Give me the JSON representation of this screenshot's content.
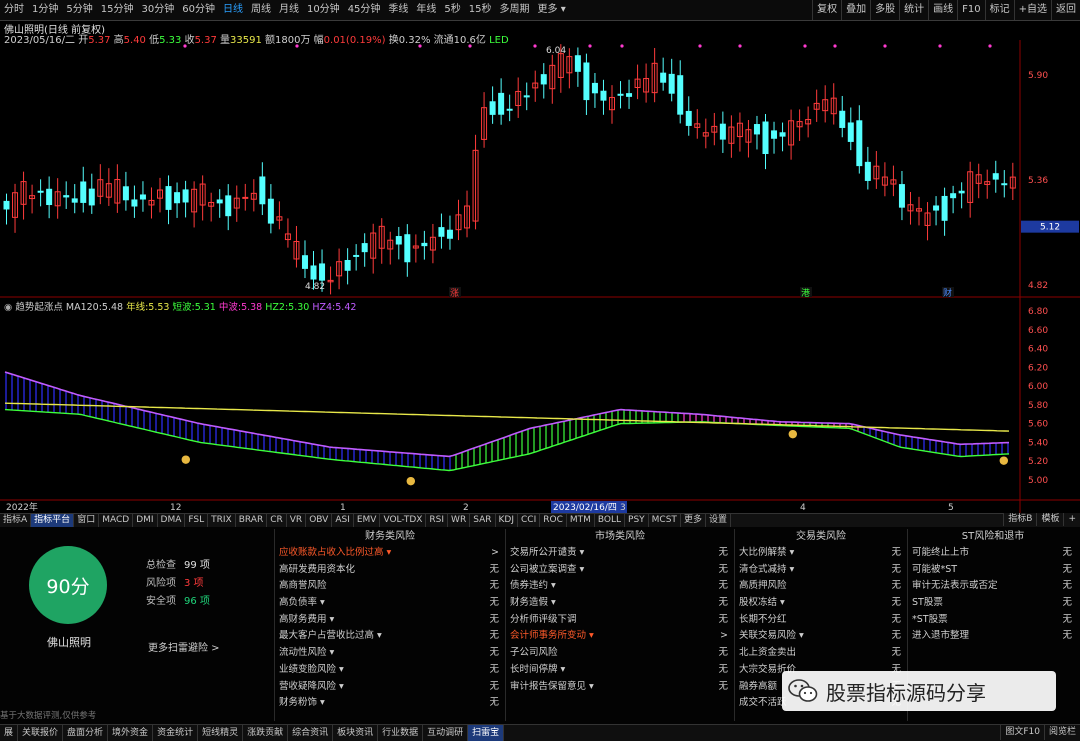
{
  "toolbar": {
    "periods": [
      "分时",
      "1分钟",
      "5分钟",
      "15分钟",
      "30分钟",
      "60分钟",
      "日线",
      "周线",
      "月线",
      "10分钟",
      "45分钟",
      "季线",
      "年线",
      "5秒",
      "15秒",
      "多周期",
      "更多 ▾"
    ],
    "active_period": "日线",
    "tools": [
      "复权",
      "叠加",
      "多股",
      "统计",
      "画线",
      "F10",
      "标记",
      "+自选",
      "返回"
    ]
  },
  "stock": {
    "title": "佛山照明(日线 前复权)",
    "date": "2023/05/16/二",
    "open_label": "开",
    "open": "5.37",
    "high_label": "高",
    "high": "5.40",
    "low_label": "低",
    "low": "5.33",
    "close_label": "收",
    "close": "5.37",
    "volume_label": "量",
    "volume": "33591",
    "amount_label": "额",
    "amount": "1800万",
    "change_label": "幅",
    "change": "0.01(0.19%)",
    "turnover_label": "换",
    "turnover": "0.32%",
    "float_label": "流通",
    "float": "10.6亿",
    "led": "LED"
  },
  "price_axis": [
    "5.90",
    "5.36",
    "4.82"
  ],
  "current_price": "5.12",
  "price_annotations": {
    "high": "6.04",
    "low": "4.82"
  },
  "markers": [
    "涨",
    "港",
    "财"
  ],
  "indicator": {
    "name": "趋势起涨点",
    "ma120_label": "MA120:",
    "ma120": "5.48",
    "year_label": "年线:",
    "year": "5.53",
    "short_label": "短波:",
    "short": "5.31",
    "mid_label": "中波:",
    "mid": "5.38",
    "hz2_label": "HZ2:",
    "hz2": "5.30",
    "hz4_label": "HZ4:",
    "hz4": "5.42",
    "axis": [
      "6.80",
      "6.60",
      "6.40",
      "6.20",
      "6.00",
      "5.80",
      "5.60",
      "5.40",
      "5.20",
      "5.00"
    ]
  },
  "time_axis": {
    "labels": [
      "2022年",
      "12",
      "1",
      "2",
      "2023/02/16/四",
      "3",
      "4",
      "5"
    ]
  },
  "tabs": [
    "指标A",
    "指标平台",
    "窗口",
    "MACD",
    "DMI",
    "DMA",
    "FSL",
    "TRIX",
    "BRAR",
    "CR",
    "VR",
    "OBV",
    "ASI",
    "EMV",
    "VOL-TDX",
    "RSI",
    "WR",
    "SAR",
    "KDJ",
    "CCI",
    "ROC",
    "MTM",
    "BOLL",
    "PSY",
    "MCST",
    "更多",
    "设置"
  ],
  "active_tab": "指标平台",
  "tab_right": [
    "指标B",
    "模板",
    "+"
  ],
  "risk": {
    "score": "90分",
    "company": "佛山照明",
    "total_label": "总检查",
    "total": "99 项",
    "risk_label": "风险项",
    "risk_count": "3 项",
    "safe_label": "安全项",
    "safe": "96 项",
    "more": "更多扫雷避险 >",
    "footnote": "基于大数据评测,仅供参考",
    "financial": {
      "title": "财务类风险",
      "items": [
        {
          "name": "应收账款占收入比例过高 ▾",
          "value": ">",
          "warn": true
        },
        {
          "name": "高研发费用资本化",
          "value": "无",
          "warn": false
        },
        {
          "name": "高商誉风险",
          "value": "无",
          "warn": false
        },
        {
          "name": "高负债率 ▾",
          "value": "无",
          "warn": false
        },
        {
          "name": "高财务费用 ▾",
          "value": "无",
          "warn": false
        },
        {
          "name": "最大客户占营收比过高 ▾",
          "value": "无",
          "warn": false
        },
        {
          "name": "流动性风险 ▾",
          "value": "无",
          "warn": false
        },
        {
          "name": "业绩变脸风险 ▾",
          "value": "无",
          "warn": false
        },
        {
          "name": "营收疑降风险 ▾",
          "value": "无",
          "warn": false
        },
        {
          "name": "财务粉饰 ▾",
          "value": "无",
          "warn": false
        }
      ]
    },
    "market": {
      "title": "市场类风险",
      "items": [
        {
          "name": "交易所公开谴责 ▾",
          "value": "无",
          "warn": false
        },
        {
          "name": "公司被立案调查 ▾",
          "value": "无",
          "warn": false
        },
        {
          "name": "债券违约 ▾",
          "value": "无",
          "warn": false
        },
        {
          "name": "财务造假 ▾",
          "value": "无",
          "warn": false
        },
        {
          "name": "分析师评级下调",
          "value": "无",
          "warn": false
        },
        {
          "name": "会计师事务所变动 ▾",
          "value": ">",
          "warn": true
        },
        {
          "name": "子公司风险",
          "value": "无",
          "warn": false
        },
        {
          "name": "长时间停牌 ▾",
          "value": "无",
          "warn": false
        },
        {
          "name": "审计报告保留意见 ▾",
          "value": "无",
          "warn": false
        }
      ]
    },
    "trade": {
      "title": "交易类风险",
      "items": [
        {
          "name": "大比例解禁 ▾",
          "value": "无",
          "warn": false
        },
        {
          "name": "清仓式减持 ▾",
          "value": "无",
          "warn": false
        },
        {
          "name": "高质押风险",
          "value": "无",
          "warn": false
        },
        {
          "name": "股权冻结 ▾",
          "value": "无",
          "warn": false
        },
        {
          "name": "长期不分红",
          "value": "无",
          "warn": false
        },
        {
          "name": "关联交易风险 ▾",
          "value": "无",
          "warn": false
        },
        {
          "name": "北上资金卖出",
          "value": "无",
          "warn": false
        },
        {
          "name": "大宗交易折价",
          "value": "无",
          "warn": false
        },
        {
          "name": "融券高额",
          "value": "无",
          "warn": false
        },
        {
          "name": "成交不活跃",
          "value": "无",
          "warn": false
        }
      ]
    },
    "st": {
      "title": "ST风险和退市",
      "items": [
        {
          "name": "可能终止上市",
          "value": "无",
          "warn": false
        },
        {
          "name": "可能被*ST",
          "value": "无",
          "warn": false
        },
        {
          "name": "审计无法表示或否定",
          "value": "无",
          "warn": false
        },
        {
          "name": "ST股票",
          "value": "无",
          "warn": false
        },
        {
          "name": "*ST股票",
          "value": "无",
          "warn": false
        },
        {
          "name": "进入退市整理",
          "value": "无",
          "warn": false
        }
      ]
    }
  },
  "bottom_tabs": [
    "展",
    "关联报价",
    "盘面分析",
    "境外资金",
    "资金统计",
    "短线精灵",
    "涨跌贡献",
    "综合资讯",
    "板块资讯",
    "行业数据",
    "互动调研",
    "扫雷宝"
  ],
  "active_bottom": "扫雷宝",
  "bottom_right": [
    "图文F10",
    "阅览栏"
  ],
  "watermark": "股票指标源码分享",
  "colors": {
    "up": "#ff3b3b",
    "down": "#54ffff",
    "accent": "#2aa0ff",
    "score": "#1fa463",
    "warn": "#ff5a2a"
  }
}
